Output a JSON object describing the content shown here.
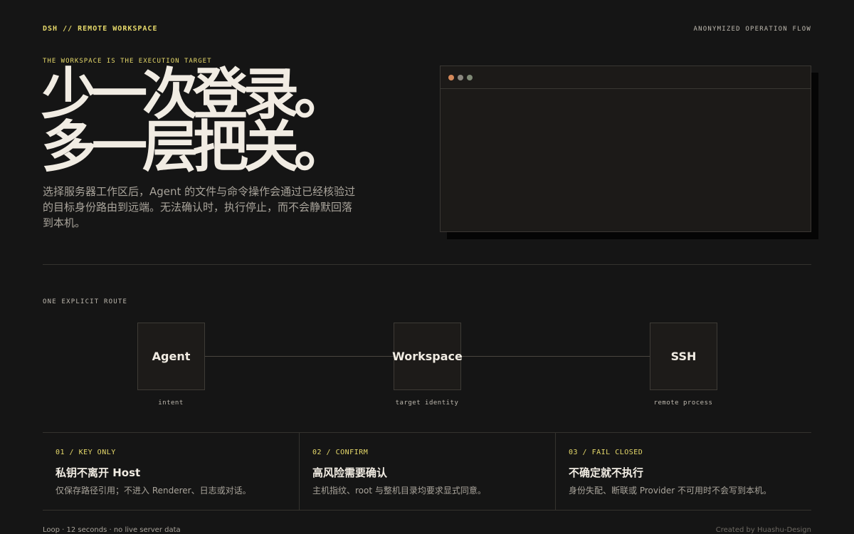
{
  "header": {
    "brand": "DSH // REMOTE WORKSPACE",
    "right_label": "ANONYMIZED OPERATION FLOW"
  },
  "hero": {
    "eyebrow": "THE WORKSPACE IS THE EXECUTION TARGET",
    "headline_line1": "少一次登录。",
    "headline_line2": "多一层把关。",
    "description": "选择服务器工作区后，Agent 的文件与命令操作会通过已经核验过的目标身份路由到远端。无法确认时，执行停止，而不会静默回落到本机。"
  },
  "window": {
    "dots": [
      {
        "name": "dot-orange",
        "color": "#d4895a"
      },
      {
        "name": "dot-grey",
        "color": "#8a877f"
      },
      {
        "name": "dot-green",
        "color": "#7f8a76"
      }
    ]
  },
  "route": {
    "label": "ONE EXPLICIT ROUTE",
    "nodes": [
      {
        "title": "Agent",
        "caption": "intent"
      },
      {
        "title": "Workspace",
        "caption": "target identity"
      },
      {
        "title": "SSH",
        "caption": "remote process"
      }
    ]
  },
  "cards": [
    {
      "tag": "01 / KEY ONLY",
      "title": "私钥不离开 Host",
      "text": "仅保存路径引用；不进入 Renderer、日志或对话。"
    },
    {
      "tag": "02 / CONFIRM",
      "title": "高风险需要确认",
      "text": "主机指纹、root 与整机目录均要求显式同意。"
    },
    {
      "tag": "03 / FAIL CLOSED",
      "title": "不确定就不执行",
      "text": "身份失配、断联或 Provider 不可用时不会写到本机。"
    }
  ],
  "footer": {
    "left": "Loop · 12 seconds · no live server data",
    "right": "Created by Huashu-Design"
  },
  "colors": {
    "background": "#151515",
    "accent": "#e6d96a",
    "text": "#f1ece3",
    "muted": "#a9a49b"
  }
}
